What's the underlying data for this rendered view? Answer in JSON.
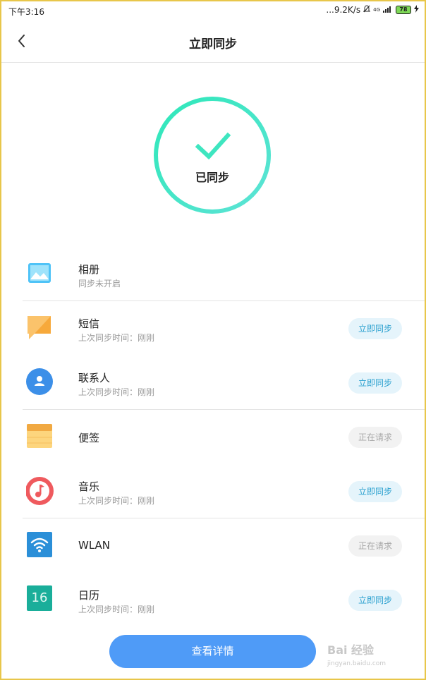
{
  "status_bar": {
    "time": "下午3:16",
    "network_speed": "...9.2K/s",
    "signal": "4G",
    "battery": "78"
  },
  "header": {
    "title": "立即同步",
    "back_icon": "chevron-left-icon"
  },
  "sync_status": {
    "label": "已同步",
    "accent_color": "#3ee6c0"
  },
  "items": [
    {
      "name": "相册",
      "subtitle": "同步未开启",
      "icon": "gallery-icon",
      "button": ""
    },
    {
      "name": "短信",
      "subtitle": "上次同步时间：刚刚",
      "icon": "message-icon",
      "button": "立即同步"
    },
    {
      "name": "联系人",
      "subtitle": "上次同步时间：刚刚",
      "icon": "contacts-icon",
      "button": "立即同步"
    },
    {
      "name": "便签",
      "subtitle": "",
      "icon": "notes-icon",
      "button": "正在请求"
    },
    {
      "name": "音乐",
      "subtitle": "上次同步时间：刚刚",
      "icon": "music-icon",
      "button": "立即同步"
    },
    {
      "name": "WLAN",
      "subtitle": "",
      "icon": "wifi-icon",
      "button": "正在请求"
    },
    {
      "name": "日历",
      "subtitle": "上次同步时间：刚刚",
      "icon": "calendar-icon",
      "button": "立即同步",
      "icon_text": "16"
    }
  ],
  "footer": {
    "details_button": "查看详情",
    "watermark": "Bai 经验",
    "watermark_url": "jingyan.baidu.com"
  }
}
